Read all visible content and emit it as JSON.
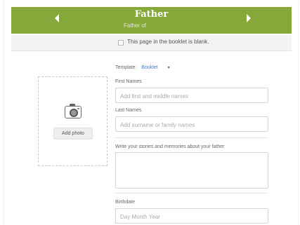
{
  "header": {
    "title": "Father",
    "subtitle": "Father of",
    "prev_icon": "chevron-left-icon",
    "next_icon": "chevron-right-icon",
    "color": "#86a83a"
  },
  "blank_page": {
    "label": "This page in the booklet is blank.",
    "checked": false
  },
  "photo": {
    "icon": "camera-icon",
    "button_label": "Add photo"
  },
  "form": {
    "template_label": "Template:",
    "template_value": "Booklet",
    "template_caret": "▾",
    "first_names_label": "First Names",
    "first_names_placeholder": "Add first and middle names",
    "last_names_label": "Last Names",
    "last_names_placeholder": "Add surname or family names",
    "stories_label": "Write your stories and memories about your father",
    "birthdate_label": "Birthdate",
    "birthdate_placeholder": "Day Month Year"
  }
}
